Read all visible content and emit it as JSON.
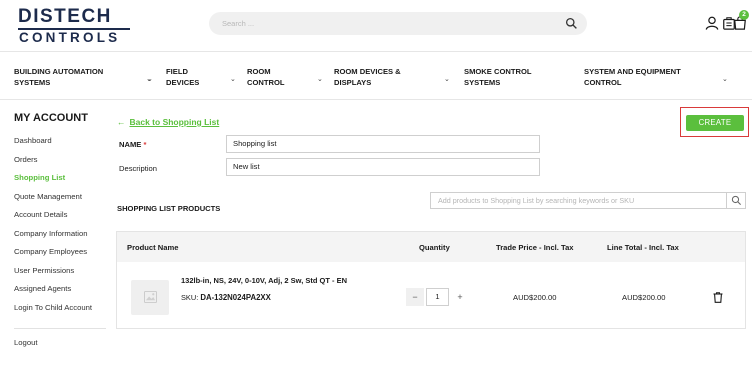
{
  "header": {
    "logo_line1": "DISTECH",
    "logo_line2": "CONTROLS",
    "search_placeholder": "Search ...",
    "cart_count": "2"
  },
  "nav": {
    "items": [
      {
        "label": "BUILDING AUTOMATION SYSTEMS"
      },
      {
        "label": "FIELD DEVICES"
      },
      {
        "label": "ROOM CONTROL"
      },
      {
        "label": "ROOM DEVICES & DISPLAYS"
      },
      {
        "label": "SMOKE CONTROL SYSTEMS"
      },
      {
        "label": "SYSTEM AND EQUIPMENT CONTROL"
      }
    ]
  },
  "sidebar": {
    "title": "MY ACCOUNT",
    "items": [
      {
        "label": "Dashboard"
      },
      {
        "label": "Orders"
      },
      {
        "label": "Shopping List"
      },
      {
        "label": "Quote Management"
      },
      {
        "label": "Account Details"
      },
      {
        "label": "Company Information"
      },
      {
        "label": "Company Employees"
      },
      {
        "label": "User Permissions"
      },
      {
        "label": "Assigned Agents"
      },
      {
        "label": "Login To Child Account"
      }
    ],
    "logout": "Logout"
  },
  "main": {
    "back_arrow": "←",
    "back_label": "Back to Shopping List",
    "create_label": "CREATE",
    "name_label": "NAME",
    "required_mark": "*",
    "name_value": "Shopping list",
    "description_label": "Description",
    "description_value": "New list",
    "products_title": "SHOPPING LIST PRODUCTS",
    "add_products_placeholder": "Add products to Shopping List by searching keywords or SKU"
  },
  "table": {
    "headers": {
      "product": "Product Name",
      "quantity": "Quantity",
      "trade_price": "Trade Price - Incl. Tax",
      "line_total": "Line Total - Incl. Tax"
    },
    "rows": [
      {
        "name": "132lb-in, NS, 24V, 0-10V, Adj, 2 Sw, Std QT - EN",
        "sku_label": "SKU:",
        "sku": "DA-132N024PA2XX",
        "quantity": "1",
        "minus": "−",
        "plus": "+",
        "trade_price": "AUD$200.00",
        "line_total": "AUD$200.00"
      }
    ]
  },
  "colors": {
    "accent": "#5bbf3d",
    "brand": "#1d2b4c",
    "highlight_border": "#d93a3a"
  },
  "icons": [
    "search-icon",
    "user-icon",
    "quote-icon",
    "cart-icon",
    "image-placeholder-icon",
    "trash-icon",
    "chevron-down-icon"
  ]
}
